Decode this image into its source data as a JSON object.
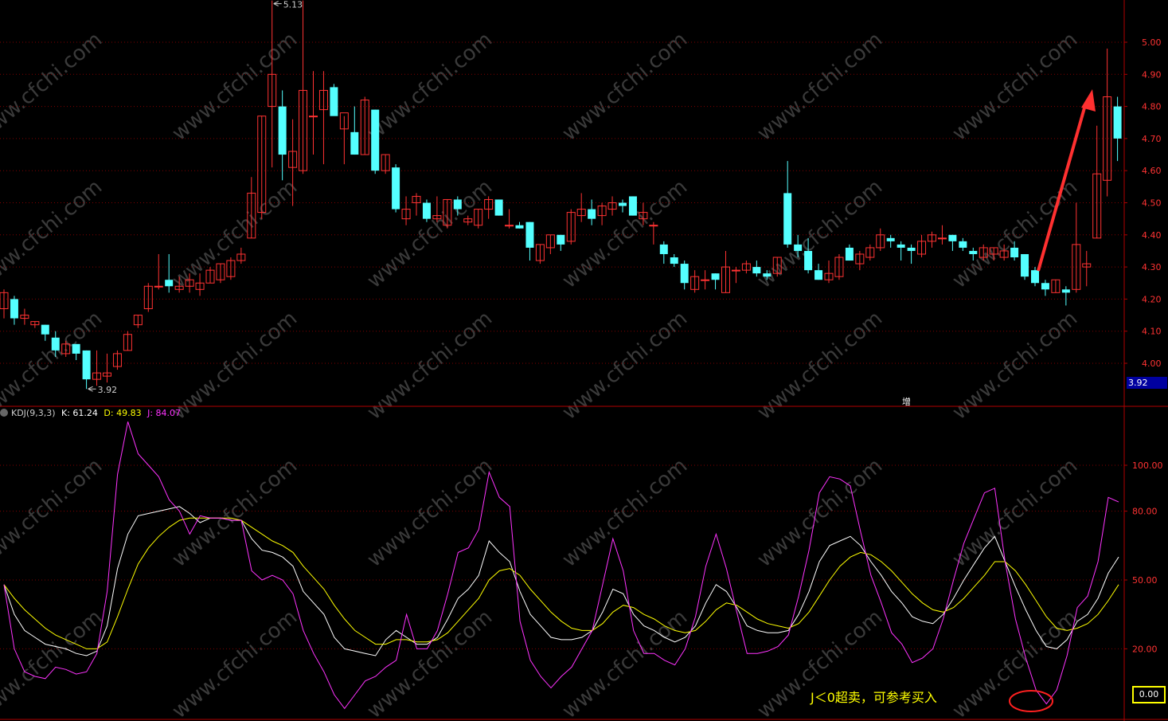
{
  "chart_data": [
    {
      "type": "candlestick",
      "title": "",
      "ylim": [
        3.92,
        5.13
      ],
      "y_ticks": [
        "5.00",
        "4.90",
        "4.80",
        "4.70",
        "4.60",
        "4.50",
        "4.40",
        "4.30",
        "4.20",
        "4.10",
        "4.00"
      ],
      "high_label": "5.13",
      "low_label": "3.92",
      "price_tag": "3.92",
      "marker_text": "增",
      "grid": true,
      "candles": [
        {
          "o": 4.17,
          "h": 4.23,
          "l": 4.14,
          "c": 4.22
        },
        {
          "o": 4.2,
          "h": 4.21,
          "l": 4.12,
          "c": 4.14
        },
        {
          "o": 4.14,
          "h": 4.17,
          "l": 4.12,
          "c": 4.15
        },
        {
          "o": 4.12,
          "h": 4.13,
          "l": 4.11,
          "c": 4.13
        },
        {
          "o": 4.12,
          "h": 4.12,
          "l": 4.07,
          "c": 4.09
        },
        {
          "o": 4.08,
          "h": 4.1,
          "l": 4.02,
          "c": 4.04
        },
        {
          "o": 4.03,
          "h": 4.07,
          "l": 4.02,
          "c": 4.06
        },
        {
          "o": 4.06,
          "h": 4.06,
          "l": 4.01,
          "c": 4.03
        },
        {
          "o": 4.04,
          "h": 4.04,
          "l": 3.92,
          "c": 3.95
        },
        {
          "o": 3.95,
          "h": 4.04,
          "l": 3.93,
          "c": 3.97
        },
        {
          "o": 3.96,
          "h": 4.03,
          "l": 3.94,
          "c": 3.97
        },
        {
          "o": 3.99,
          "h": 4.04,
          "l": 3.98,
          "c": 4.03
        },
        {
          "o": 4.04,
          "h": 4.1,
          "l": 4.04,
          "c": 4.09
        },
        {
          "o": 4.12,
          "h": 4.15,
          "l": 4.11,
          "c": 4.15
        },
        {
          "o": 4.17,
          "h": 4.25,
          "l": 4.16,
          "c": 4.24
        },
        {
          "o": 4.24,
          "h": 4.34,
          "l": 4.23,
          "c": 4.24
        },
        {
          "o": 4.26,
          "h": 4.34,
          "l": 4.22,
          "c": 4.24
        },
        {
          "o": 4.23,
          "h": 4.27,
          "l": 4.22,
          "c": 4.24
        },
        {
          "o": 4.24,
          "h": 4.28,
          "l": 4.22,
          "c": 4.26
        },
        {
          "o": 4.23,
          "h": 4.28,
          "l": 4.21,
          "c": 4.25
        },
        {
          "o": 4.25,
          "h": 4.3,
          "l": 4.25,
          "c": 4.29
        },
        {
          "o": 4.26,
          "h": 4.31,
          "l": 4.25,
          "c": 4.31
        },
        {
          "o": 4.27,
          "h": 4.33,
          "l": 4.26,
          "c": 4.32
        },
        {
          "o": 4.32,
          "h": 4.36,
          "l": 4.31,
          "c": 4.34
        },
        {
          "o": 4.39,
          "h": 4.58,
          "l": 4.39,
          "c": 4.53
        },
        {
          "o": 4.47,
          "h": 4.77,
          "l": 4.45,
          "c": 4.77
        },
        {
          "o": 4.8,
          "h": 5.13,
          "l": 4.61,
          "c": 4.9
        },
        {
          "o": 4.8,
          "h": 4.85,
          "l": 4.57,
          "c": 4.65
        },
        {
          "o": 4.61,
          "h": 4.76,
          "l": 4.49,
          "c": 4.66
        },
        {
          "o": 4.6,
          "h": 5.13,
          "l": 4.59,
          "c": 4.85
        },
        {
          "o": 4.77,
          "h": 4.91,
          "l": 4.65,
          "c": 4.77
        },
        {
          "o": 4.79,
          "h": 4.91,
          "l": 4.62,
          "c": 4.85
        },
        {
          "o": 4.86,
          "h": 4.87,
          "l": 4.78,
          "c": 4.77
        },
        {
          "o": 4.73,
          "h": 4.77,
          "l": 4.62,
          "c": 4.78
        },
        {
          "o": 4.72,
          "h": 4.8,
          "l": 4.65,
          "c": 4.65
        },
        {
          "o": 4.65,
          "h": 4.83,
          "l": 4.65,
          "c": 4.82
        },
        {
          "o": 4.79,
          "h": 4.79,
          "l": 4.59,
          "c": 4.6
        },
        {
          "o": 4.6,
          "h": 4.65,
          "l": 4.59,
          "c": 4.65
        },
        {
          "o": 4.61,
          "h": 4.62,
          "l": 4.47,
          "c": 4.48
        },
        {
          "o": 4.45,
          "h": 4.52,
          "l": 4.43,
          "c": 4.48
        },
        {
          "o": 4.5,
          "h": 4.53,
          "l": 4.46,
          "c": 4.52
        },
        {
          "o": 4.5,
          "h": 4.51,
          "l": 4.44,
          "c": 4.45
        },
        {
          "o": 4.45,
          "h": 4.52,
          "l": 4.44,
          "c": 4.46
        },
        {
          "o": 4.43,
          "h": 4.51,
          "l": 4.42,
          "c": 4.51
        },
        {
          "o": 4.51,
          "h": 4.52,
          "l": 4.46,
          "c": 4.48
        },
        {
          "o": 4.44,
          "h": 4.46,
          "l": 4.43,
          "c": 4.45
        },
        {
          "o": 4.43,
          "h": 4.48,
          "l": 4.42,
          "c": 4.48
        },
        {
          "o": 4.48,
          "h": 4.52,
          "l": 4.45,
          "c": 4.51
        },
        {
          "o": 4.51,
          "h": 4.51,
          "l": 4.46,
          "c": 4.46
        },
        {
          "o": 4.43,
          "h": 4.48,
          "l": 4.42,
          "c": 4.43
        },
        {
          "o": 4.43,
          "h": 4.44,
          "l": 4.42,
          "c": 4.42
        },
        {
          "o": 4.44,
          "h": 4.44,
          "l": 4.32,
          "c": 4.36
        },
        {
          "o": 4.32,
          "h": 4.37,
          "l": 4.31,
          "c": 4.37
        },
        {
          "o": 4.36,
          "h": 4.4,
          "l": 4.34,
          "c": 4.4
        },
        {
          "o": 4.4,
          "h": 4.4,
          "l": 4.35,
          "c": 4.37
        },
        {
          "o": 4.38,
          "h": 4.48,
          "l": 4.37,
          "c": 4.47
        },
        {
          "o": 4.46,
          "h": 4.53,
          "l": 4.44,
          "c": 4.48
        },
        {
          "o": 4.48,
          "h": 4.51,
          "l": 4.43,
          "c": 4.45
        },
        {
          "o": 4.46,
          "h": 4.5,
          "l": 4.43,
          "c": 4.49
        },
        {
          "o": 4.48,
          "h": 4.52,
          "l": 4.46,
          "c": 4.5
        },
        {
          "o": 4.5,
          "h": 4.51,
          "l": 4.47,
          "c": 4.49
        },
        {
          "o": 4.52,
          "h": 4.52,
          "l": 4.46,
          "c": 4.46
        },
        {
          "o": 4.45,
          "h": 4.5,
          "l": 4.43,
          "c": 4.47
        },
        {
          "o": 4.43,
          "h": 4.44,
          "l": 4.37,
          "c": 4.43
        },
        {
          "o": 4.37,
          "h": 4.38,
          "l": 4.31,
          "c": 4.34
        },
        {
          "o": 4.33,
          "h": 4.34,
          "l": 4.3,
          "c": 4.31
        },
        {
          "o": 4.31,
          "h": 4.32,
          "l": 4.23,
          "c": 4.25
        },
        {
          "o": 4.23,
          "h": 4.29,
          "l": 4.22,
          "c": 4.27
        },
        {
          "o": 4.26,
          "h": 4.29,
          "l": 4.23,
          "c": 4.26
        },
        {
          "o": 4.28,
          "h": 4.28,
          "l": 4.23,
          "c": 4.26
        },
        {
          "o": 4.22,
          "h": 4.35,
          "l": 4.22,
          "c": 4.3
        },
        {
          "o": 4.29,
          "h": 4.3,
          "l": 4.25,
          "c": 4.29
        },
        {
          "o": 4.29,
          "h": 4.32,
          "l": 4.28,
          "c": 4.31
        },
        {
          "o": 4.3,
          "h": 4.32,
          "l": 4.27,
          "c": 4.28
        },
        {
          "o": 4.28,
          "h": 4.29,
          "l": 4.26,
          "c": 4.27
        },
        {
          "o": 4.28,
          "h": 4.33,
          "l": 4.27,
          "c": 4.33
        },
        {
          "o": 4.53,
          "h": 4.63,
          "l": 4.36,
          "c": 4.37
        },
        {
          "o": 4.37,
          "h": 4.4,
          "l": 4.33,
          "c": 4.35
        },
        {
          "o": 4.35,
          "h": 4.39,
          "l": 4.28,
          "c": 4.29
        },
        {
          "o": 4.29,
          "h": 4.31,
          "l": 4.26,
          "c": 4.26
        },
        {
          "o": 4.26,
          "h": 4.32,
          "l": 4.25,
          "c": 4.28
        },
        {
          "o": 4.27,
          "h": 4.34,
          "l": 4.26,
          "c": 4.33
        },
        {
          "o": 4.36,
          "h": 4.37,
          "l": 4.32,
          "c": 4.32
        },
        {
          "o": 4.31,
          "h": 4.35,
          "l": 4.29,
          "c": 4.34
        },
        {
          "o": 4.33,
          "h": 4.37,
          "l": 4.32,
          "c": 4.36
        },
        {
          "o": 4.36,
          "h": 4.42,
          "l": 4.35,
          "c": 4.4
        },
        {
          "o": 4.39,
          "h": 4.4,
          "l": 4.36,
          "c": 4.38
        },
        {
          "o": 4.37,
          "h": 4.38,
          "l": 4.32,
          "c": 4.36
        },
        {
          "o": 4.36,
          "h": 4.37,
          "l": 4.31,
          "c": 4.35
        },
        {
          "o": 4.34,
          "h": 4.4,
          "l": 4.33,
          "c": 4.38
        },
        {
          "o": 4.38,
          "h": 4.41,
          "l": 4.36,
          "c": 4.4
        },
        {
          "o": 4.39,
          "h": 4.43,
          "l": 4.37,
          "c": 4.39
        },
        {
          "o": 4.4,
          "h": 4.4,
          "l": 4.35,
          "c": 4.38
        },
        {
          "o": 4.38,
          "h": 4.39,
          "l": 4.35,
          "c": 4.36
        },
        {
          "o": 4.35,
          "h": 4.36,
          "l": 4.32,
          "c": 4.34
        },
        {
          "o": 4.33,
          "h": 4.37,
          "l": 4.32,
          "c": 4.36
        },
        {
          "o": 4.34,
          "h": 4.36,
          "l": 4.32,
          "c": 4.36
        },
        {
          "o": 4.33,
          "h": 4.37,
          "l": 4.32,
          "c": 4.35
        },
        {
          "o": 4.36,
          "h": 4.38,
          "l": 4.32,
          "c": 4.33
        },
        {
          "o": 4.34,
          "h": 4.34,
          "l": 4.26,
          "c": 4.27
        },
        {
          "o": 4.29,
          "h": 4.3,
          "l": 4.24,
          "c": 4.25
        },
        {
          "o": 4.25,
          "h": 4.26,
          "l": 4.21,
          "c": 4.23
        },
        {
          "o": 4.22,
          "h": 4.26,
          "l": 4.22,
          "c": 4.26
        },
        {
          "o": 4.23,
          "h": 4.24,
          "l": 4.18,
          "c": 4.22
        },
        {
          "o": 4.23,
          "h": 4.5,
          "l": 4.22,
          "c": 4.37
        },
        {
          "o": 4.3,
          "h": 4.35,
          "l": 4.24,
          "c": 4.31
        },
        {
          "o": 4.39,
          "h": 4.74,
          "l": 4.39,
          "c": 4.59
        },
        {
          "o": 4.57,
          "h": 4.98,
          "l": 4.52,
          "c": 4.83
        },
        {
          "o": 4.8,
          "h": 4.83,
          "l": 4.63,
          "c": 4.7
        }
      ]
    },
    {
      "type": "line",
      "title": "",
      "indicator_name": "KDJ(9,3,3)",
      "legend_k": "K: 61.24",
      "legend_d": "D: 49.83",
      "legend_j": "J: 84.07",
      "y_ticks": [
        "100.00",
        "80.00",
        "50.00",
        "20.00"
      ],
      "zero_label": "0.00",
      "ylim": [
        -5,
        125
      ],
      "grid": true,
      "annotation": "J＜0超卖，可参考买入",
      "series": [
        {
          "name": "K",
          "color": "#ffffff",
          "values": [
            48,
            35,
            28,
            25,
            22,
            21,
            20,
            18,
            17,
            19,
            30,
            55,
            70,
            78,
            79,
            80,
            81,
            82,
            79,
            75,
            77,
            77,
            76,
            76,
            68,
            63,
            62,
            60,
            56,
            45,
            40,
            35,
            25,
            20,
            19,
            18,
            17,
            24,
            28,
            25,
            22,
            22,
            25,
            33,
            42,
            46,
            52,
            67,
            62,
            58,
            45,
            35,
            30,
            25,
            24,
            24,
            25,
            28,
            36,
            46,
            44,
            35,
            30,
            28,
            25,
            23,
            25,
            30,
            40,
            48,
            45,
            38,
            30,
            28,
            27,
            27,
            28,
            35,
            45,
            58,
            65,
            67,
            69,
            65,
            58,
            52,
            45,
            40,
            34,
            32,
            31,
            35,
            42,
            50,
            57,
            64,
            69,
            58,
            47,
            37,
            28,
            21,
            20,
            24,
            32,
            35,
            42,
            53,
            60
          ]
        },
        {
          "name": "D",
          "color": "#ffff00",
          "values": [
            48,
            42,
            37,
            33,
            29,
            26,
            24,
            22,
            20,
            20,
            23,
            34,
            46,
            57,
            64,
            69,
            73,
            76,
            77,
            77,
            77,
            77,
            77,
            76,
            73,
            70,
            67,
            65,
            62,
            56,
            51,
            46,
            39,
            33,
            28,
            25,
            22,
            22,
            24,
            24,
            23,
            23,
            24,
            27,
            32,
            37,
            42,
            50,
            54,
            55,
            52,
            46,
            41,
            36,
            32,
            29,
            28,
            28,
            31,
            36,
            39,
            38,
            35,
            33,
            30,
            28,
            27,
            28,
            32,
            37,
            40,
            39,
            36,
            33,
            31,
            30,
            29,
            31,
            36,
            43,
            50,
            56,
            60,
            62,
            61,
            58,
            54,
            49,
            44,
            40,
            37,
            36,
            38,
            42,
            47,
            52,
            58,
            58,
            54,
            48,
            41,
            34,
            29,
            28,
            29,
            31,
            35,
            41,
            48
          ]
        },
        {
          "name": "J",
          "color": "#ff33ff",
          "values": [
            48,
            20,
            10,
            8,
            7,
            12,
            11,
            9,
            10,
            18,
            45,
            96,
            119,
            105,
            100,
            95,
            85,
            80,
            70,
            78,
            77,
            77,
            76,
            76,
            54,
            50,
            52,
            50,
            44,
            28,
            18,
            10,
            0,
            -6,
            0,
            6,
            8,
            12,
            15,
            35,
            20,
            20,
            28,
            44,
            62,
            64,
            72,
            97,
            86,
            82,
            32,
            15,
            8,
            3,
            8,
            12,
            20,
            28,
            48,
            68,
            54,
            28,
            18,
            18,
            15,
            13,
            20,
            34,
            56,
            70,
            55,
            36,
            18,
            18,
            19,
            21,
            26,
            43,
            63,
            88,
            95,
            94,
            91,
            71,
            52,
            40,
            27,
            22,
            14,
            16,
            20,
            33,
            50,
            66,
            77,
            88,
            90,
            58,
            33,
            16,
            2,
            -4,
            2,
            17,
            38,
            43,
            58,
            86,
            84
          ]
        }
      ]
    }
  ]
}
